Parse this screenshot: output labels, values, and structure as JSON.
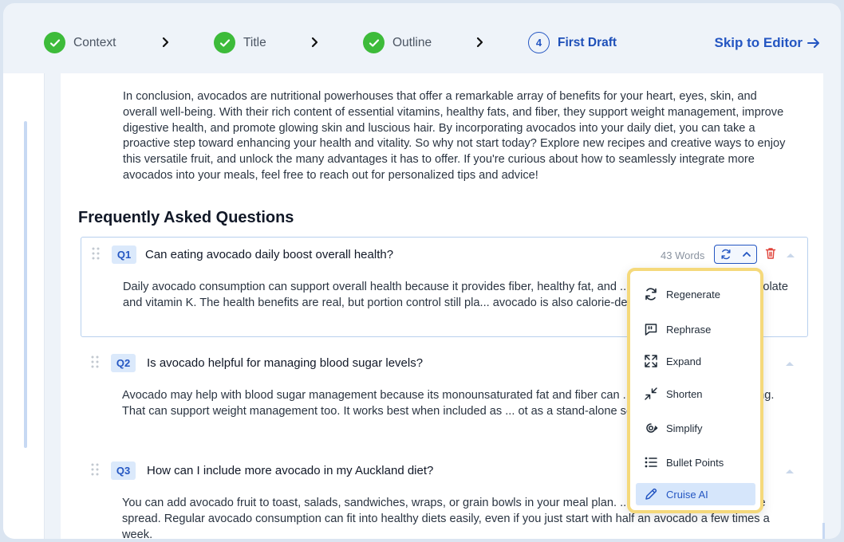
{
  "stepper": {
    "steps": [
      {
        "label": "Context",
        "state": "done"
      },
      {
        "label": "Title",
        "state": "done"
      },
      {
        "label": "Outline",
        "state": "done"
      },
      {
        "label": "First Draft",
        "state": "current",
        "number": "4"
      }
    ],
    "skip_label": "Skip to Editor"
  },
  "content": {
    "conclusion": "In conclusion, avocados are nutritional powerhouses that offer a remarkable array of benefits for your heart, eyes, skin, and overall well-being. With their rich content of essential vitamins, healthy fats, and fiber, they support weight management, improve digestive health, and promote glowing skin and luscious hair. By incorporating avocados into your daily diet, you can take a proactive step toward enhancing your health and vitality. So why not start today? Explore new recipes and creative ways to enjoy this versatile fruit, and unlock the many advantages it has to offer. If you're curious about how to seamlessly integrate more avocados into your meals, feel free to reach out for personalized tips and advice!",
    "faq_title": "Frequently Asked Questions",
    "faqs": [
      {
        "badge": "Q1",
        "question": "Can eating avocado daily boost overall health?",
        "answer": "Daily avocado consumption can support overall health because it provides fiber, healthy fat, and ... ng daily value, including folate and vitamin K. The health benefits are real, but portion control still pla... avocado is also calorie-dense.",
        "words": "43 Words"
      },
      {
        "badge": "Q2",
        "question": "Is avocado helpful for managing blood sugar levels?",
        "answer": "Avocado may help with blood sugar management because its monounsaturated fat and fiber can ... eep meals more satisfying. That can support weight management too. It works best when included as ... ot as a stand-alone solution."
      },
      {
        "badge": "Q3",
        "question": "How can I include more avocado in my Auckland diet?",
        "answer": "You can add avocado fruit to toast, salads, sandwiches, wraps, or grain bowls in your meal plan. ... guacamole or as a simple spread. Regular avocado consumption can fit into healthy diets easily, even if you just start with half an avocado a few times a week."
      }
    ]
  },
  "menu": {
    "items": [
      {
        "label": "Regenerate",
        "icon": "regenerate-icon"
      },
      {
        "label": "Rephrase",
        "icon": "rephrase-icon"
      },
      {
        "label": "Expand",
        "icon": "expand-icon"
      },
      {
        "label": "Shorten",
        "icon": "shorten-icon"
      },
      {
        "label": "Simplify",
        "icon": "simplify-icon"
      },
      {
        "label": "Bullet Points",
        "icon": "bullet-points-icon"
      },
      {
        "label": "Cruise AI",
        "icon": "pencil-icon",
        "active": true
      }
    ]
  },
  "colors": {
    "accent": "#2456c2",
    "success": "#3dbb3a",
    "menu_highlight": "#f5d97b",
    "active_item": "#d6e6fb"
  }
}
